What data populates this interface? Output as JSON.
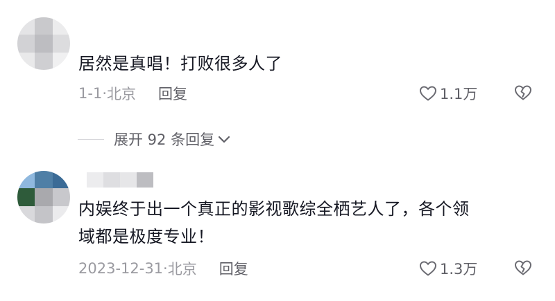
{
  "comments": [
    {
      "text": "居然是真唱！打败很多人了",
      "date": "1-1",
      "location": "北京",
      "reply_label": "回复",
      "likes": "1.1万"
    },
    {
      "text_line1": "内娱终于出一个真正的影视歌综全栖艺人了，各个领",
      "text_line2": "域都是极度专业！",
      "date": "2023-12-31",
      "location": "北京",
      "reply_label": "回复",
      "likes": "1.3万"
    }
  ],
  "expand_replies": {
    "label": "展开 92 条回复"
  },
  "icons": {
    "like": "heart-outline-icon",
    "dislike": "broken-heart-icon",
    "expand": "chevron-down-icon"
  },
  "colors": {
    "text": "#161823",
    "meta": "#9a9aa0",
    "secondary": "#5f5f66"
  }
}
